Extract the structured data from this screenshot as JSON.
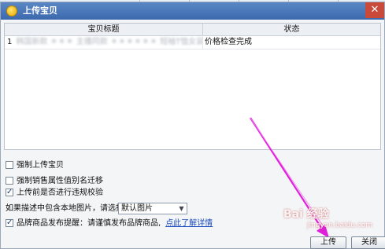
{
  "dialog": {
    "title": "上传宝贝",
    "close_glyph": "✕"
  },
  "grid": {
    "columns": [
      "宝贝标题",
      "状态"
    ],
    "rows": [
      {
        "index": "1",
        "title_blurred": "韩国新款 ＊＊＊ 主播同款 ＊＊＊＊＊＊ 短袖T恤女装 ＊＊＊ CFL",
        "title_visible": "0100",
        "status": "价格检查完成"
      }
    ]
  },
  "options": {
    "force_upload": "强制上传宝贝",
    "force_sale_attr": "强制销售属性值别名迁移",
    "precheck": "上传前是否进行违规校验",
    "local_image_label": "如果描述中包含本地图片，请选择分类",
    "local_image_value": "默认图片",
    "brand_notice_label": "品牌商品发布提醒：请谨慎发布品牌商品,",
    "brand_notice_link": "点此了解详情"
  },
  "buttons": {
    "upload": "上传",
    "close": "关闭"
  },
  "watermark": {
    "main": "Bai  经验",
    "sub": "jingyan.baidu.com"
  },
  "colors": {
    "annotation_arrow": "#e020d8",
    "titlebar": "#3b69ad"
  }
}
